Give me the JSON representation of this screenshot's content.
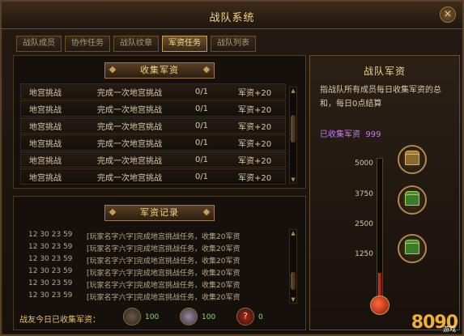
{
  "window": {
    "title": "战队系统",
    "close_label": "×"
  },
  "tabs": [
    {
      "label": "战队成员"
    },
    {
      "label": "协作任务"
    },
    {
      "label": "战队纹章"
    },
    {
      "label": "军资任务",
      "active": true
    },
    {
      "label": "战队列表"
    }
  ],
  "collect": {
    "header": "收集军资",
    "tasks": [
      {
        "name": "地宫挑战",
        "desc": "完成一次地宫挑战",
        "progress": "0/1",
        "reward": "军资+20"
      },
      {
        "name": "地宫挑战",
        "desc": "完成一次地宫挑战",
        "progress": "0/1",
        "reward": "军资+20"
      },
      {
        "name": "地宫挑战",
        "desc": "完成一次地宫挑战",
        "progress": "0/1",
        "reward": "军资+20"
      },
      {
        "name": "地宫挑战",
        "desc": "完成一次地宫挑战",
        "progress": "0/1",
        "reward": "军资+20"
      },
      {
        "name": "地宫挑战",
        "desc": "完成一次地宫挑战",
        "progress": "0/1",
        "reward": "军资+20"
      },
      {
        "name": "地宫挑战",
        "desc": "完成一次地宫挑战",
        "progress": "0/1",
        "reward": "军资+20"
      }
    ]
  },
  "log": {
    "header": "军资记录",
    "entries": [
      {
        "time": "12 30 23 59",
        "text": "[玩家名字六字]完成地宫挑战任务，收集20军资"
      },
      {
        "time": "12 30 23 59",
        "text": "[玩家名字六字]完成地宫挑战任务，收集20军资"
      },
      {
        "time": "12 30 23 59",
        "text": "[玩家名字六字]完成地宫挑战任务，收集20军资"
      },
      {
        "time": "12 30 23 59",
        "text": "[玩家名字六字]完成地宫挑战任务，收集20军资"
      },
      {
        "time": "12 30 23 59",
        "text": "[玩家名字六字]完成地宫挑战任务，收集20军资"
      },
      {
        "time": "12 30 23 59",
        "text": "[玩家名字六字]完成地宫挑战任务，收集20军资"
      }
    ]
  },
  "today": {
    "label": "战友今日已收集军资：",
    "members": [
      {
        "icon": "warrior-avatar-icon",
        "value": "100"
      },
      {
        "icon": "mage-avatar-icon",
        "value": "100"
      },
      {
        "icon": "unknown-avatar-icon",
        "glyph": "?",
        "value": "0"
      }
    ]
  },
  "reward": {
    "title": "战队军资",
    "desc": "指战队所有成员每日收集军资的总和，每日0点结算",
    "collected_label": "已收集军资",
    "collected_value": "999",
    "max": 5000,
    "ticks": [
      "5000",
      "3750",
      "2500",
      "1250"
    ],
    "chests": [
      {
        "icon": "gold-chest-icon",
        "color": "#8a6a2a"
      },
      {
        "icon": "green-chest-icon",
        "color": "#3a7a2a"
      },
      {
        "icon": "green-chest-icon",
        "color": "#3a7a2a"
      }
    ]
  },
  "watermark": {
    "brand": "8090",
    "sub": "游戏"
  }
}
